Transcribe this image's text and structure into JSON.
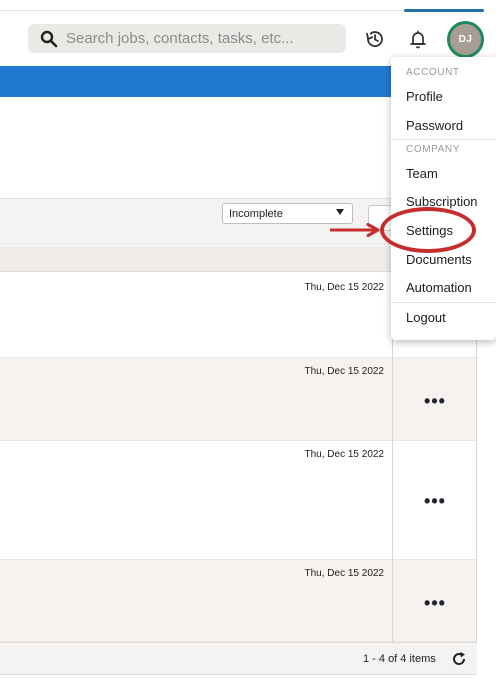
{
  "header": {
    "search_placeholder": "Search jobs, contacts, tasks, etc...",
    "avatar_initials": "DJ"
  },
  "toolbar": {
    "filter_value": "Incomplete"
  },
  "rows": [
    {
      "date": "Thu, Dec 15 2022"
    },
    {
      "date": "Thu, Dec 15 2022"
    },
    {
      "date": "Thu, Dec 15 2022"
    },
    {
      "date": "Thu, Dec 15 2022"
    }
  ],
  "row_menu_glyph": "•••",
  "footer": {
    "page_info": "1 - 4 of 4 items"
  },
  "menu": {
    "account_label": "ACCOUNT",
    "profile": "Profile",
    "password": "Password",
    "company_label": "COMPANY",
    "team": "Team",
    "subscription": "Subscription",
    "settings": "Settings",
    "documents": "Documents",
    "automation": "Automation",
    "logout": "Logout"
  },
  "icons": {
    "search": "search-icon",
    "history": "history-icon",
    "notifications": "bell-icon",
    "refresh": "refresh-icon"
  },
  "colors": {
    "banner": "#1f7bd0",
    "avatar_ring": "#1e8a5e",
    "annotation": "#c62d2d"
  }
}
